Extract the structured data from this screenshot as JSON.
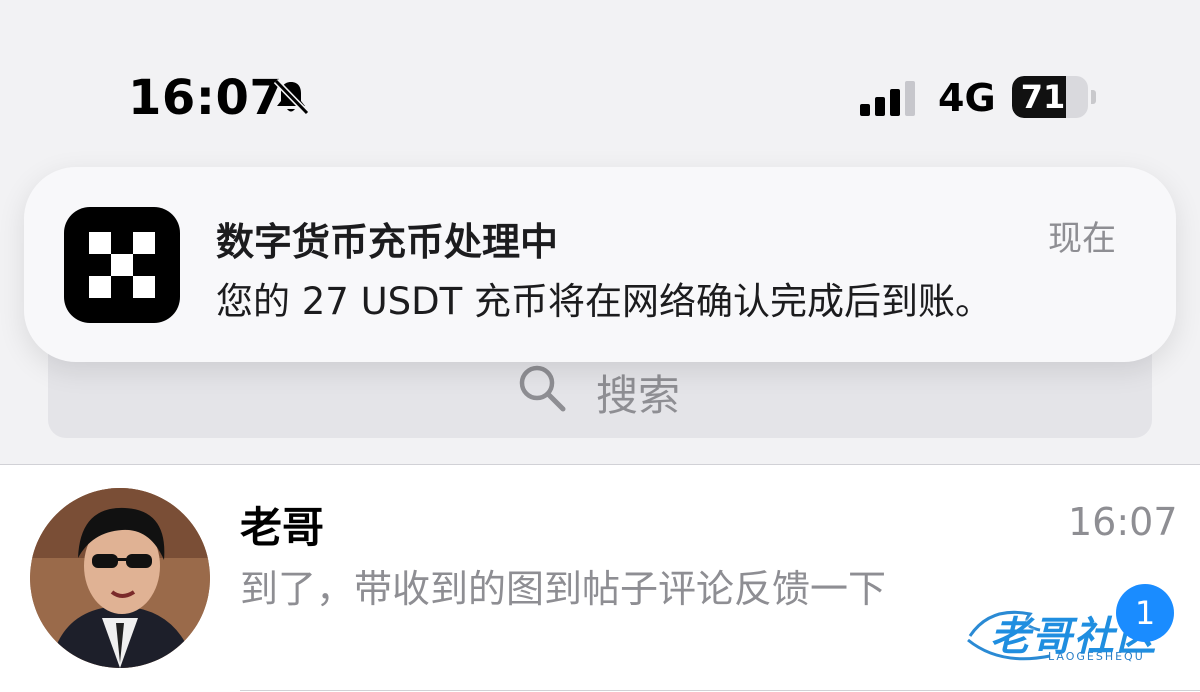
{
  "status_bar": {
    "time": "16:07",
    "network": "4G",
    "battery_level": 71,
    "battery_label": "71",
    "icons": [
      "bell-slash-icon",
      "cellular-signal-icon",
      "battery-icon"
    ]
  },
  "notification": {
    "app_icon": "okx-logo-icon",
    "title": "数字货币充币处理中",
    "time": "现在",
    "body": "您的 27 USDT 充币将在网络确认完成后到账。"
  },
  "search": {
    "placeholder": "搜索",
    "icon": "search-icon"
  },
  "chats": [
    {
      "name": "老哥",
      "time": "16:07",
      "preview": "到了，带收到的图到帖子评论反馈一下",
      "unread": "1"
    }
  ],
  "watermark": {
    "text": "老哥社区",
    "sub": "LAOGESHEQU"
  },
  "colors": {
    "background": "#f2f2f4",
    "badge": "#1a8cff",
    "secondary_text": "#8e8e93"
  }
}
